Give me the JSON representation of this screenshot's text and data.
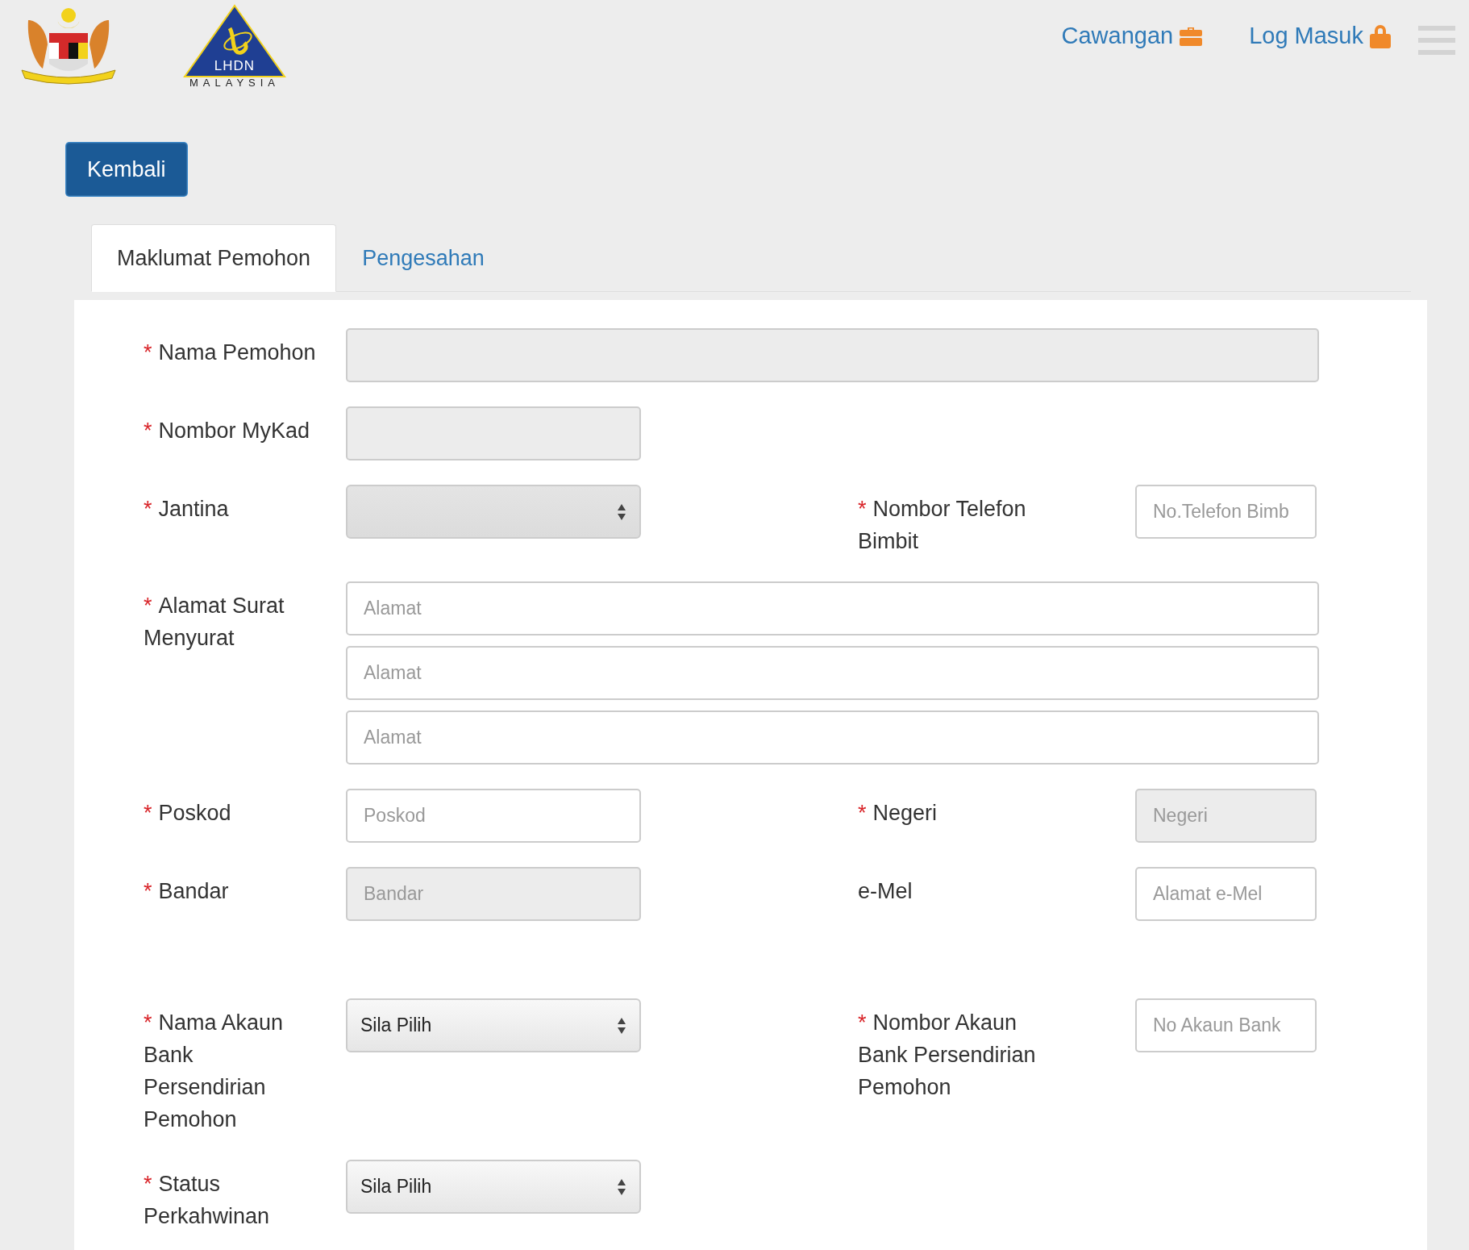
{
  "header": {
    "logo": {
      "title": "LHDN",
      "subtitle": "MALAYSIA"
    },
    "links": [
      {
        "label": "Cawangan"
      },
      {
        "label": "Log Masuk"
      }
    ]
  },
  "back_button": "Kembali",
  "tabs": [
    {
      "label": "Maklumat Pemohon",
      "selected": true
    },
    {
      "label": "Pengesahan",
      "selected": false
    }
  ],
  "form": {
    "sections": [
      {
        "rows": [
          {
            "fields": [
              {
                "marker": "*",
                "label": "Nama Pemohon",
                "inputs": [
                  {
                    "kind": "wide",
                    "disabled": true
                  }
                ]
              }
            ]
          },
          {
            "fields": [
              {
                "marker": "*",
                "label": "Nombor MyKad",
                "inputs": [
                  {
                    "kind": "text",
                    "disabled": true
                  }
                ]
              }
            ]
          },
          {
            "fields": [
              {
                "marker": "*",
                "label": "Jantina",
                "inputs": [
                  {
                    "kind": "select",
                    "disabled": true
                  }
                ]
              },
              {
                "marker": "*",
                "label": "Nombor Telefon Bimbit",
                "inputs": [
                  {
                    "kind": "text",
                    "placeholder": "No.Telefon Bimb",
                    "disabled": false
                  }
                ]
              }
            ]
          },
          {
            "fields": [
              {
                "marker": "*",
                "label": "Alamat Surat Menyurat",
                "inputs": [
                  {
                    "kind": "wide",
                    "placeholder": "Alamat",
                    "disabled": false
                  },
                  {
                    "kind": "wide",
                    "placeholder": "Alamat",
                    "disabled": false
                  },
                  {
                    "kind": "wide",
                    "placeholder": "Alamat",
                    "disabled": false
                  }
                ]
              }
            ]
          },
          {
            "fields": [
              {
                "marker": "*",
                "label": "Poskod",
                "inputs": [
                  {
                    "kind": "text",
                    "placeholder": "Poskod",
                    "disabled": false
                  }
                ]
              },
              {
                "marker": "*",
                "label": "Negeri",
                "inputs": [
                  {
                    "kind": "text",
                    "placeholder": "Negeri",
                    "disabled": true
                  }
                ]
              }
            ]
          },
          {
            "fields": [
              {
                "marker": "*",
                "label": "Bandar",
                "inputs": [
                  {
                    "kind": "text",
                    "placeholder": "Bandar",
                    "disabled": true
                  }
                ]
              },
              {
                "label": "e-Mel",
                "inputs": [
                  {
                    "kind": "text",
                    "placeholder": "Alamat e-Mel",
                    "disabled": false
                  }
                ]
              }
            ]
          }
        ]
      },
      {
        "rows": [
          {
            "fields": [
              {
                "marker": "*",
                "label": "Nama Akaun Bank Persendirian Pemohon",
                "inputs": [
                  {
                    "kind": "select",
                    "value": "Sila Pilih",
                    "disabled": false
                  }
                ]
              },
              {
                "marker": "*",
                "label": "Nombor Akaun Bank Persendirian Pemohon",
                "inputs": [
                  {
                    "kind": "text",
                    "placeholder": "No Akaun Bank",
                    "disabled": false
                  }
                ]
              }
            ]
          },
          {
            "fields": [
              {
                "marker": "*",
                "label": "Status Perkahwinan",
                "inputs": [
                  {
                    "kind": "select",
                    "value": "Sila Pilih",
                    "disabled": false
                  }
                ]
              }
            ]
          }
        ]
      }
    ]
  }
}
